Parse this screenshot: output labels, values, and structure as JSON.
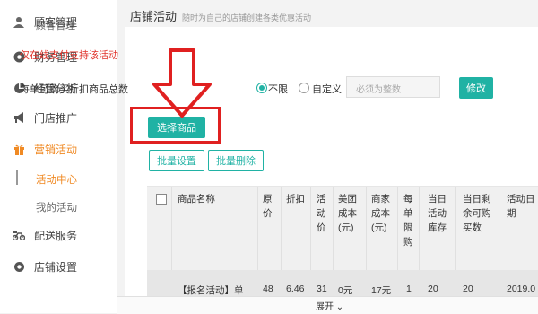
{
  "sidebar": {
    "ghost_label": "顾客管理",
    "items": [
      {
        "label": "顾客管理",
        "icon": "user-icon"
      },
      {
        "label": "财务管理",
        "icon": "wallet-icon"
      },
      {
        "label": "经营分析",
        "icon": "pie-chart-icon"
      },
      {
        "label": "门店推广",
        "icon": "megaphone-icon"
      },
      {
        "label": "营销活动",
        "icon": "gift-icon",
        "active": true
      },
      {
        "label": "配送服务",
        "icon": "scooter-icon"
      },
      {
        "label": "店铺设置",
        "icon": "gear-icon"
      }
    ],
    "sub_items": [
      {
        "label": "活动中心",
        "active": true
      },
      {
        "label": "我的活动"
      }
    ]
  },
  "header": {
    "title": "店铺活动",
    "subtitle": "随时为自己的店铺创建各类优惠活动"
  },
  "form": {
    "notice": "仅在线支付支持该活动",
    "limit_label": "每单可购买折扣商品总数",
    "option_unlimited": "不限",
    "option_custom": "自定义",
    "custom_placeholder": "必须为整数",
    "modify_button": "修改",
    "select_goods_button": "选择商品",
    "batch_set_button": "批量设置",
    "batch_delete_button": "批量删除"
  },
  "table": {
    "headers": [
      "商品名称",
      "原\n价",
      "折扣",
      "活\n动\n价",
      "美团\n成本\n(元)",
      "商家\n成本\n(元)",
      "每\n单\n限\n购",
      "当日\n活动\n库存",
      "当日剩\n余可购\n买数",
      "活动日期"
    ],
    "row": [
      "【报名活动】单",
      "48",
      "6.46",
      "31",
      "0元",
      "17元",
      "1",
      "20",
      "20",
      "2019.0"
    ]
  },
  "footer": {
    "expand_label": "展开 ⌄"
  },
  "colors": {
    "accent": "#20b2a4",
    "active": "#f08a24",
    "annotation": "#e02020",
    "notice": "#e0332b"
  }
}
